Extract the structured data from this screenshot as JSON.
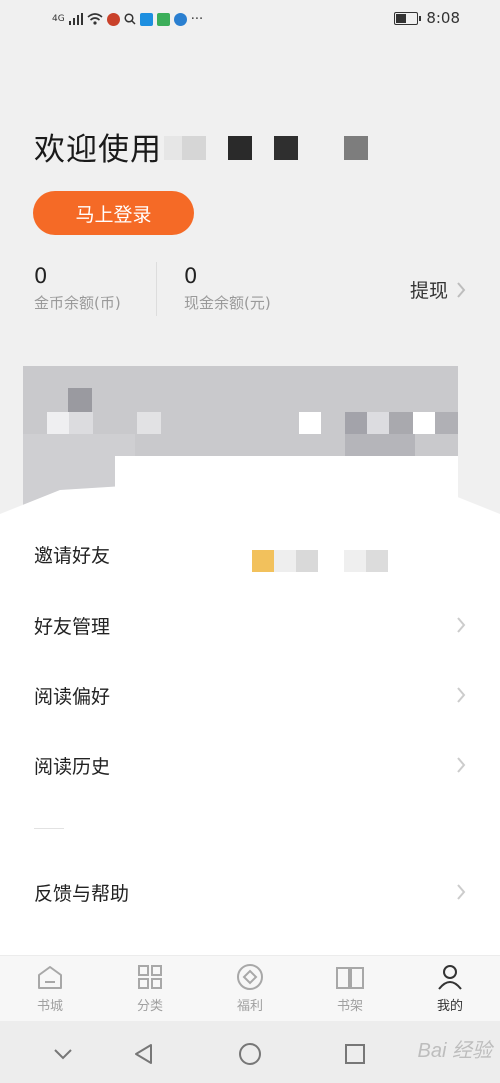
{
  "status_bar": {
    "network": "4G",
    "time": "8:08",
    "more": "···"
  },
  "header": {
    "welcome_text": "欢迎使用",
    "login_button": "马上登录",
    "coins": {
      "value": "0",
      "label": "金币余额(币)"
    },
    "cash": {
      "value": "0",
      "label": "现金余额(元)"
    },
    "withdraw_label": "提现"
  },
  "menu": [
    {
      "label": "邀请好友",
      "has_chevron": false
    },
    {
      "label": "好友管理",
      "has_chevron": true
    },
    {
      "label": "阅读偏好",
      "has_chevron": true
    },
    {
      "label": "阅读历史",
      "has_chevron": true
    },
    {
      "label": "反馈与帮助",
      "has_chevron": true
    }
  ],
  "tabs": [
    {
      "label": "书城",
      "icon": "home-icon",
      "active": false
    },
    {
      "label": "分类",
      "icon": "grid-icon",
      "active": false
    },
    {
      "label": "福利",
      "icon": "gift-icon",
      "active": false
    },
    {
      "label": "书架",
      "icon": "book-icon",
      "active": false
    },
    {
      "label": "我的",
      "icon": "profile-icon",
      "active": true
    }
  ],
  "colors": {
    "accent": "#f56a26",
    "background": "#f0f0f0"
  },
  "watermark": "Bai 经验"
}
